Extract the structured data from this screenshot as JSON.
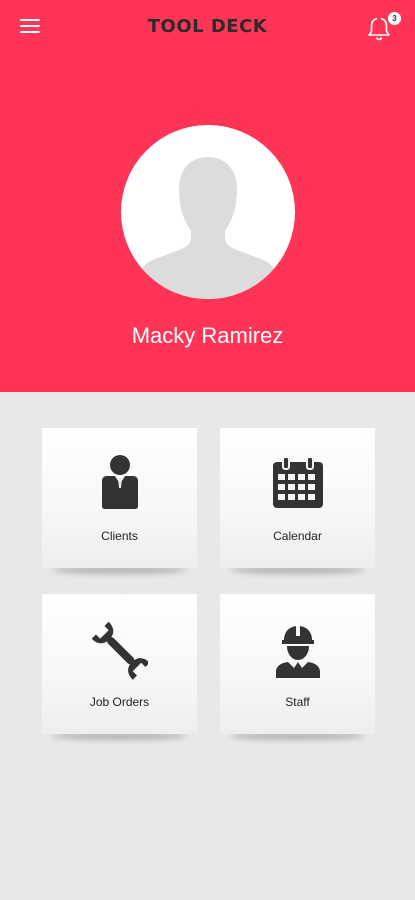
{
  "header": {
    "app_title": "TOOL DECK",
    "notification_count": "3",
    "background_color": "#ff3457"
  },
  "profile": {
    "name": "Macky Ramirez"
  },
  "tiles": [
    {
      "label": "Clients",
      "icon": "person-icon"
    },
    {
      "label": "Calendar",
      "icon": "calendar-icon"
    },
    {
      "label": "Job Orders",
      "icon": "wrench-icon"
    },
    {
      "label": "Staff",
      "icon": "worker-helmet-icon"
    }
  ]
}
